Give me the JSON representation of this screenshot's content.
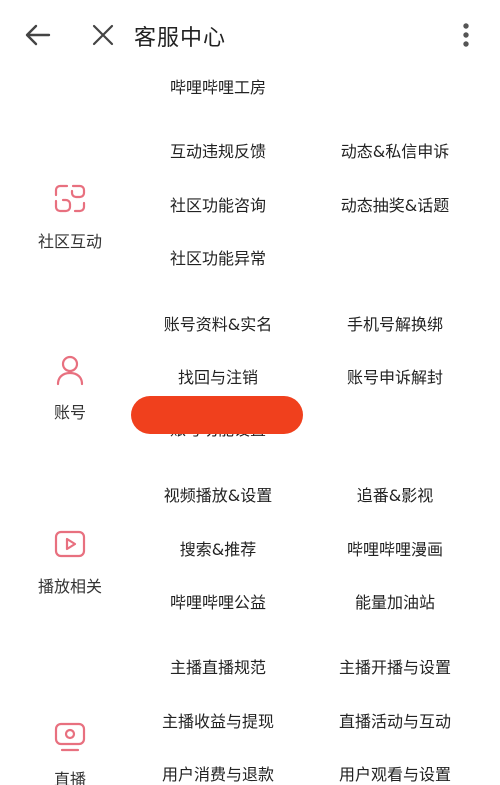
{
  "header": {
    "title": "客服中心",
    "icons": {
      "back": "arrow-left-icon",
      "close": "close-icon",
      "more": "more-vertical-icon"
    }
  },
  "theme": {
    "accent": "#e8707f",
    "redact": "#f0401d"
  },
  "top_item": "哔哩哔哩工房",
  "sections": [
    {
      "label": "社区互动",
      "icon": "community-interaction-icon",
      "items": [
        "互动违规反馈",
        "动态&私信申诉",
        "社区功能咨询",
        "动态抽奖&话题",
        "社区功能异常"
      ]
    },
    {
      "label": "账号",
      "icon": "user-icon",
      "items": [
        "账号资料&实名",
        "手机号解换绑",
        "找回与注销",
        "账号申诉解封",
        "账号功能设置"
      ]
    },
    {
      "label": "播放相关",
      "icon": "play-icon",
      "items": [
        "视频播放&设置",
        "追番&影视",
        "搜索&推荐",
        "哔哩哔哩漫画",
        "哔哩哔哩公益",
        "能量加油站"
      ]
    },
    {
      "label": "直播",
      "icon": "live-tv-icon",
      "items": [
        "主播直播规范",
        "主播开播与设置",
        "主播收益与提现",
        "直播活动与互动",
        "用户消费与退款",
        "用户观看与设置"
      ]
    }
  ]
}
